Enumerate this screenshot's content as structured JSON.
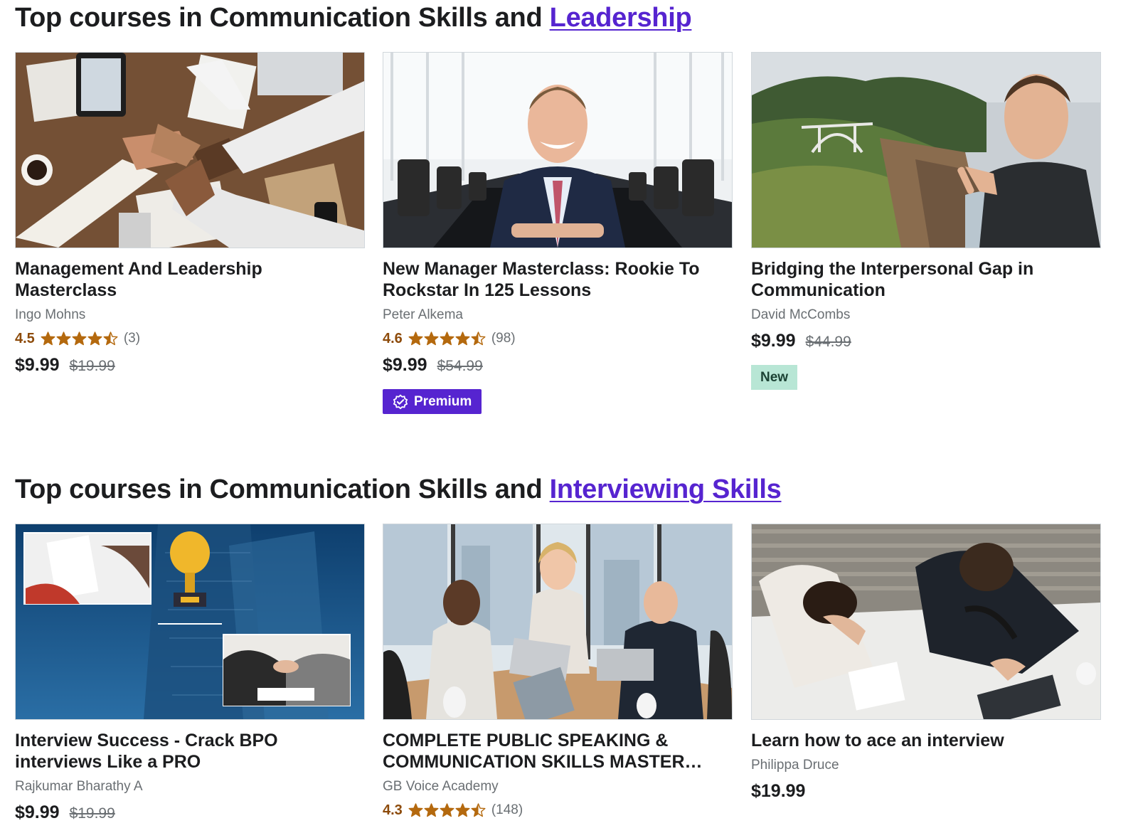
{
  "sections": [
    {
      "title_prefix": "Top courses in Communication Skills and",
      "title_link": "Leadership",
      "courses": [
        {
          "title": "Management And Leadership Masterclass",
          "author": "Ingo Mohns",
          "rating": "4.5",
          "rating_value": 4.5,
          "reviews": "(3)",
          "price": "$9.99",
          "original_price": "$19.99",
          "badge": ""
        },
        {
          "title": "New Manager Masterclass: Rookie To Rockstar In 125 Lessons",
          "author": "Peter Alkema",
          "rating": "4.6",
          "rating_value": 4.6,
          "reviews": "(98)",
          "price": "$9.99",
          "original_price": "$54.99",
          "badge": "Premium"
        },
        {
          "title": "Bridging the Interpersonal Gap in Communication",
          "author": "David McCombs",
          "rating": "",
          "reviews": "",
          "price": "$9.99",
          "original_price": "$44.99",
          "badge": "New"
        }
      ]
    },
    {
      "title_prefix": "Top courses in Communication Skills and",
      "title_link": "Interviewing Skills",
      "courses": [
        {
          "title": "Interview Success - Crack BPO interviews Like a PRO",
          "author": "Rajkumar Bharathy A",
          "rating": "",
          "reviews": "",
          "price": "$9.99",
          "original_price": "$19.99",
          "badge": ""
        },
        {
          "title": "COMPLETE PUBLIC SPEAKING & COMMUNICATION SKILLS MASTER…",
          "author": "GB Voice Academy",
          "rating": "4.3",
          "rating_value": 4.3,
          "reviews": "(148)",
          "price": "",
          "original_price": "",
          "badge": ""
        },
        {
          "title": "Learn how to ace an interview",
          "author": "Philippa Druce",
          "rating": "",
          "reviews": "",
          "price": "$19.99",
          "original_price": "",
          "badge": ""
        }
      ]
    }
  ],
  "colors": {
    "link": "#5624d0",
    "rating": "#8d4b0b",
    "star": "#b4690e",
    "premium_bg": "#5624d0",
    "new_bg": "#b8e6d5"
  },
  "icons": {
    "star": "star-icon",
    "premium": "premium-verified-icon"
  }
}
